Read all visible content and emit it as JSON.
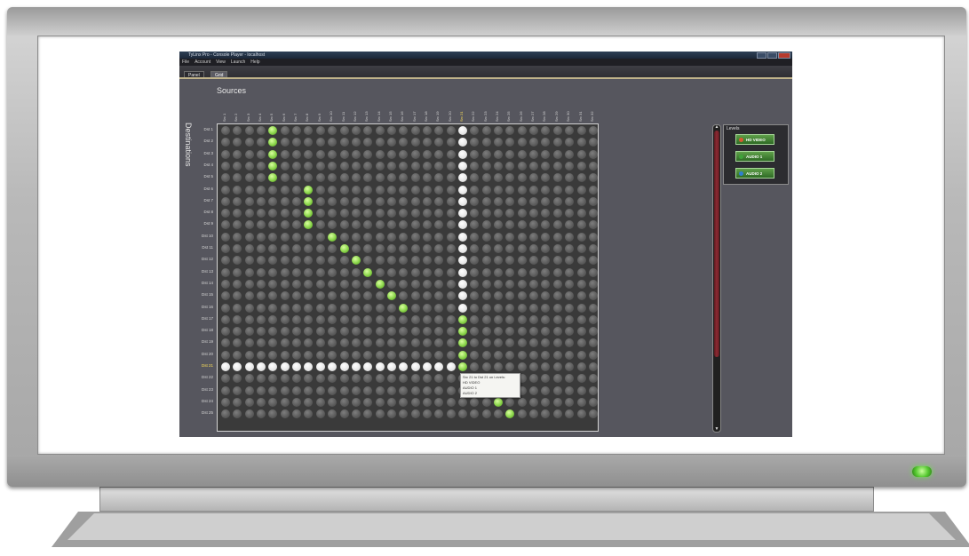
{
  "window": {
    "title": "TyLinx Pro - Console Player - localhost"
  },
  "menu": [
    "File",
    "Account",
    "View",
    "Launch",
    "Help"
  ],
  "tabs": [
    {
      "label": "Panel"
    },
    {
      "label": "Grid"
    }
  ],
  "grid": {
    "sources_title": "Sources",
    "destinations_title": "Destinations",
    "columns": [
      "Src 1",
      "Src 2",
      "Src 3",
      "Src 4",
      "Src 5",
      "Src 6",
      "Src 7",
      "Src 8",
      "Src 9",
      "Src 10",
      "Src 11",
      "Src 12",
      "Src 13",
      "Src 14",
      "Src 15",
      "Src 16",
      "Src 17",
      "Src 18",
      "Src 19",
      "Src 20",
      "Src 21",
      "Src 22",
      "Src 23",
      "Src 24",
      "Src 25",
      "Src 26",
      "Src 27",
      "Src 28",
      "Src 29",
      "Src 30",
      "Src 31",
      "Src 32"
    ],
    "rows": [
      "Dst 1",
      "Dst 2",
      "Dst 3",
      "Dst 4",
      "Dst 5",
      "Dst 6",
      "Dst 7",
      "Dst 8",
      "Dst 9",
      "Dst 10",
      "Dst 11",
      "Dst 12",
      "Dst 13",
      "Dst 14",
      "Dst 15",
      "Dst 16",
      "Dst 17",
      "Dst 18",
      "Dst 19",
      "Dst 20",
      "Dst 21",
      "Dst 22",
      "Dst 23",
      "Dst 24",
      "Dst 25"
    ],
    "selected_column": "Src 21",
    "selected_row": "Dst 21",
    "connections": [
      [
        1,
        5
      ],
      [
        2,
        5
      ],
      [
        3,
        5
      ],
      [
        4,
        5
      ],
      [
        5,
        5
      ],
      [
        6,
        8
      ],
      [
        7,
        8
      ],
      [
        8,
        8
      ],
      [
        9,
        8
      ],
      [
        10,
        10
      ],
      [
        11,
        11
      ],
      [
        12,
        12
      ],
      [
        13,
        13
      ],
      [
        14,
        14
      ],
      [
        15,
        15
      ],
      [
        16,
        16
      ],
      [
        17,
        21
      ],
      [
        18,
        21
      ],
      [
        19,
        21
      ],
      [
        20,
        21
      ],
      [
        21,
        21
      ],
      [
        22,
        22
      ],
      [
        23,
        23
      ],
      [
        24,
        24
      ],
      [
        25,
        25
      ]
    ],
    "tooltip": [
      "Src 21 to Dst 21 on Levels:",
      "HD VIDEO",
      "AUDIO 1",
      "AUDIO 2"
    ]
  },
  "levels": {
    "title": "Levels",
    "buttons": [
      {
        "label": "HD VIDEO",
        "led_color": "#d85a30"
      },
      {
        "label": "AUDIO 1",
        "led_color": "#3fa23a"
      },
      {
        "label": "AUDIO 2",
        "led_color": "#2f7fd0"
      }
    ]
  },
  "colors": {
    "connected": "#88d448",
    "highlight": "#ffffff",
    "inactive": "#5a5a5a",
    "selected_label": "#ffe25a"
  }
}
